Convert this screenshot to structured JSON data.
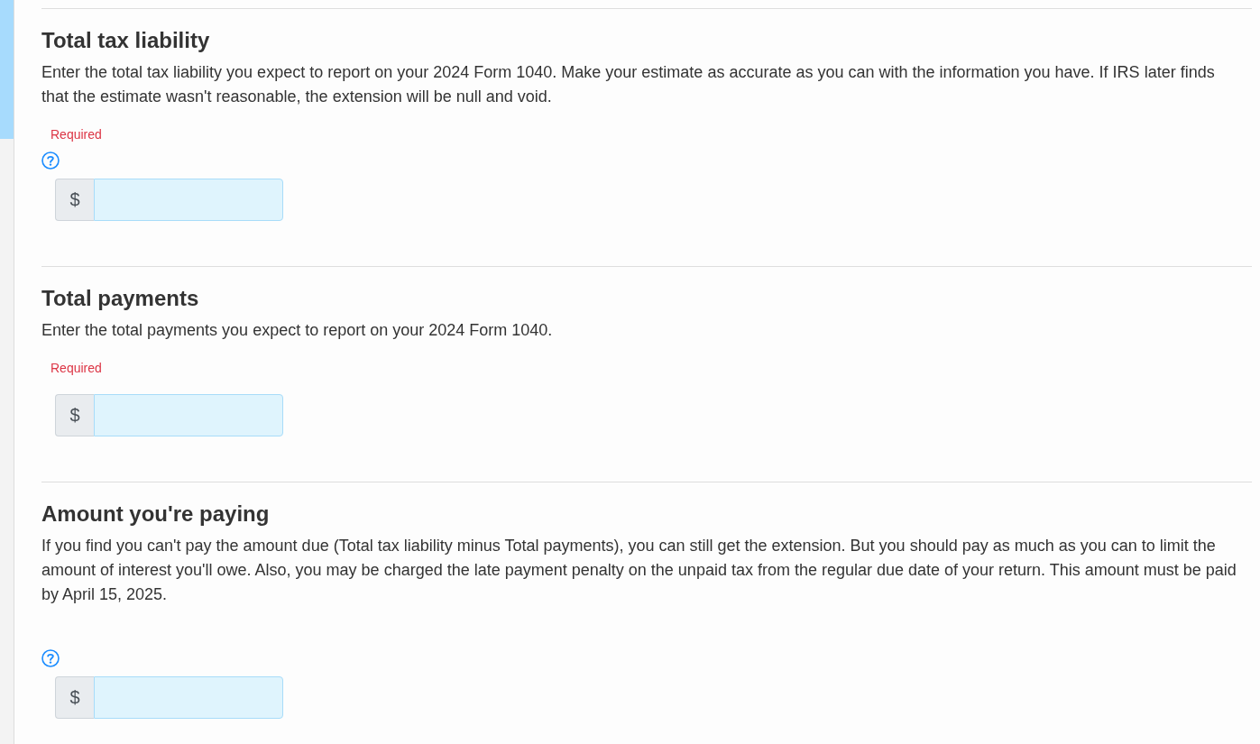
{
  "sections": [
    {
      "title": "Total tax liability",
      "description": "Enter the total tax liability you expect to report on your 2024 Form 1040. Make your estimate as accurate as you can with the information you have. If IRS later finds that the estimate wasn't reasonable, the extension will be null and void.",
      "required_label": "Required",
      "help": true,
      "prefix": "$"
    },
    {
      "title": "Total payments",
      "description": "Enter the total payments you expect to report on your 2024 Form 1040.",
      "required_label": "Required",
      "help": false,
      "prefix": "$"
    },
    {
      "title": "Amount you're paying",
      "description": "If you find you can't pay the amount due (Total tax liability minus Total payments), you can still get the extension. But you should pay as much as you can to limit the amount of interest you'll owe. Also, you may be charged the late payment penalty on the unpaid tax from the regular due date of your return. This amount must be paid by April 15, 2025.",
      "help": true,
      "prefix": "$"
    }
  ]
}
